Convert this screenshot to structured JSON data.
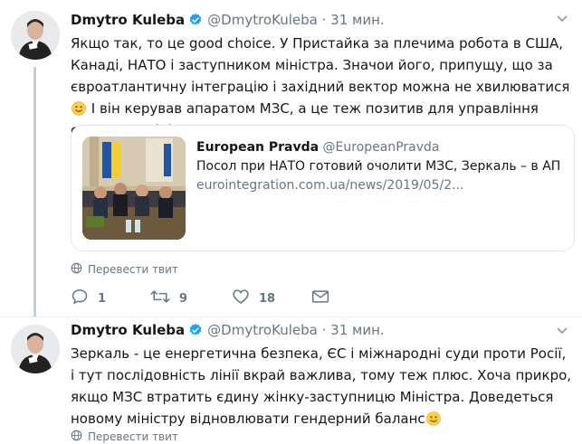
{
  "colors": {
    "accent": "#1da1f2",
    "text": "#14171a",
    "muted": "#657786",
    "border": "#e1e8ed"
  },
  "tweets": [
    {
      "author_name": "Dmytro Kuleba",
      "author_handle": "@DmytroKuleba",
      "separator": "·",
      "time": "31 мин.",
      "text_part1": "Якщо так, то це good choice. У Пристайка за плечима робота в США, Канаді, НАТО і заступником міністра. Значои його, припущу, що за євроатлантичну інтеграцію і західний вектор можна не хвилюватися",
      "text_part2": " І він керував апаратом МЗС, а це теж позитив для управління складним міністерством",
      "card": {
        "name": "European Pravda",
        "handle": "@EuropeanPravda",
        "description": "Посол при НАТО готовий очолити МЗС, Зеркаль – в АП",
        "link": "eurointegration.com.ua/news/2019/05/2..."
      },
      "translate_label": "Перевести твит",
      "actions": {
        "reply_count": "1",
        "retweet_count": "9",
        "like_count": "18"
      }
    },
    {
      "author_name": "Dmytro Kuleba",
      "author_handle": "@DmytroKuleba",
      "separator": "·",
      "time": "31 мин.",
      "text_part1": "Зеркаль - це енергетична безпека, ЄС і міжнародні суди проти Росії, і тут послідовність лінії вкрай важлива, тому теж плюс. Хоча прикро, якщо МЗС втратить єдину жінку-заступницю Міністра. Доведеться новому міністру відновлювати гендерний баланс",
      "translate_label": "Перевести твит"
    }
  ],
  "icons": {
    "verified": "verified-badge-icon",
    "more": "chevron-down-icon",
    "globe": "globe-icon",
    "reply": "reply-icon",
    "retweet": "retweet-icon",
    "like": "heart-icon",
    "dm": "envelope-icon",
    "emoji": "slightly-smiling-face-emoji"
  }
}
